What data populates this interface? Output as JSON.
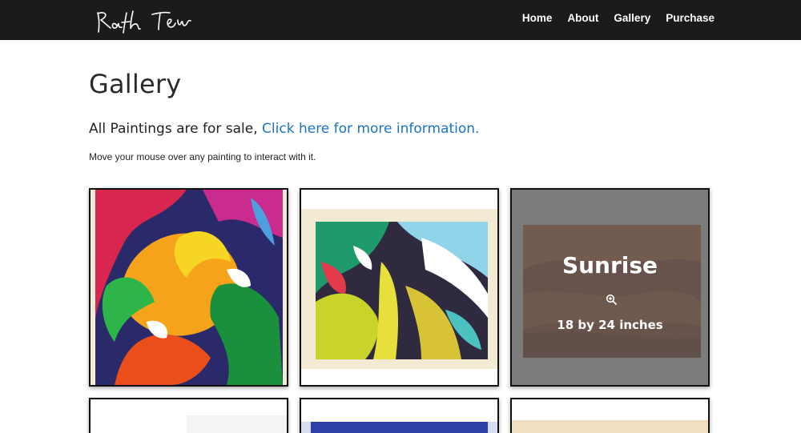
{
  "header": {
    "logo_text": "Rafeh Tew",
    "nav": [
      {
        "label": "Home"
      },
      {
        "label": "About"
      },
      {
        "label": "Gallery"
      },
      {
        "label": "Purchase"
      }
    ]
  },
  "page": {
    "title": "Gallery",
    "sale_prefix": "All Paintings are for sale, ",
    "sale_link": "Click here for more information.",
    "hint": "Move your mouse over any painting to interact with it."
  },
  "gallery": {
    "hovered_card": {
      "title": "Sunrise",
      "icon": "zoom-in-icon",
      "size": "18 by 24 inches"
    }
  },
  "colors": {
    "header_bg": "#1b1b1b",
    "link": "#1a73c8"
  }
}
